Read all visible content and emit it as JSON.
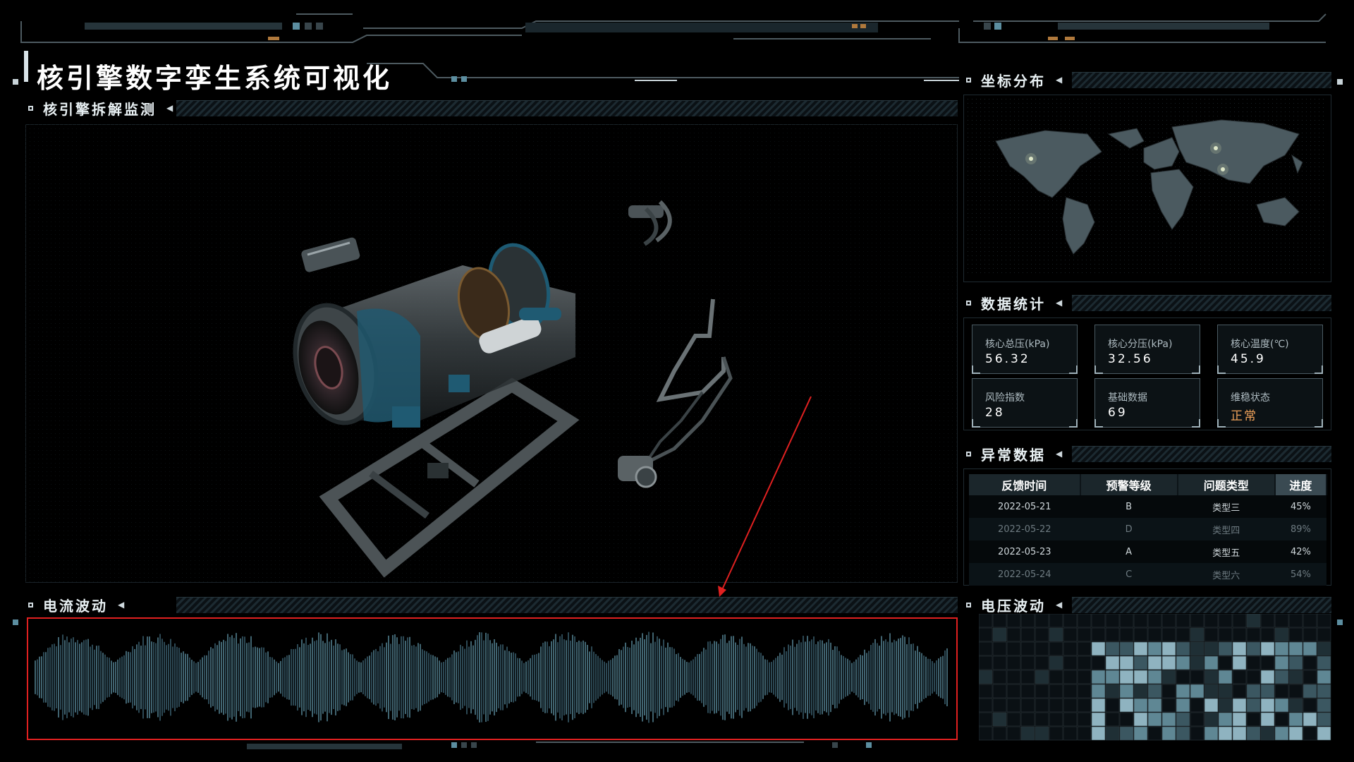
{
  "title": "核引擎数字孪生系统可视化",
  "panels": {
    "engine": "核引擎拆解监测",
    "map": "坐标分布",
    "stats": "数据统计",
    "anomaly": "异常数据",
    "current": "电流波动",
    "voltage": "电压波动"
  },
  "stats": [
    {
      "label": "核心总压(kPa)",
      "value": "56.32"
    },
    {
      "label": "核心分压(kPa)",
      "value": "32.56"
    },
    {
      "label": "核心温度(℃)",
      "value": "45.9"
    },
    {
      "label": "风险指数",
      "value": "28"
    },
    {
      "label": "基础数据",
      "value": "69"
    },
    {
      "label": "维稳状态",
      "value": "正常"
    }
  ],
  "anomaly_table": {
    "headers": [
      "反馈时间",
      "预警等级",
      "问题类型",
      "进度"
    ],
    "rows": [
      [
        "2022-05-21",
        "B",
        "类型三",
        "45%"
      ],
      [
        "2022-05-22",
        "D",
        "类型四",
        "89%"
      ],
      [
        "2022-05-23",
        "A",
        "类型五",
        "42%"
      ],
      [
        "2022-05-24",
        "C",
        "类型六",
        "54%"
      ]
    ]
  },
  "colors": {
    "accent": "#5c8ea0",
    "warning": "#f0a25a",
    "highlight_box": "#e02020",
    "panel_line": "#27363d"
  },
  "icons": {
    "panel_marker": "square-outline-icon",
    "panel_arrow": "triangle-left-icon"
  }
}
